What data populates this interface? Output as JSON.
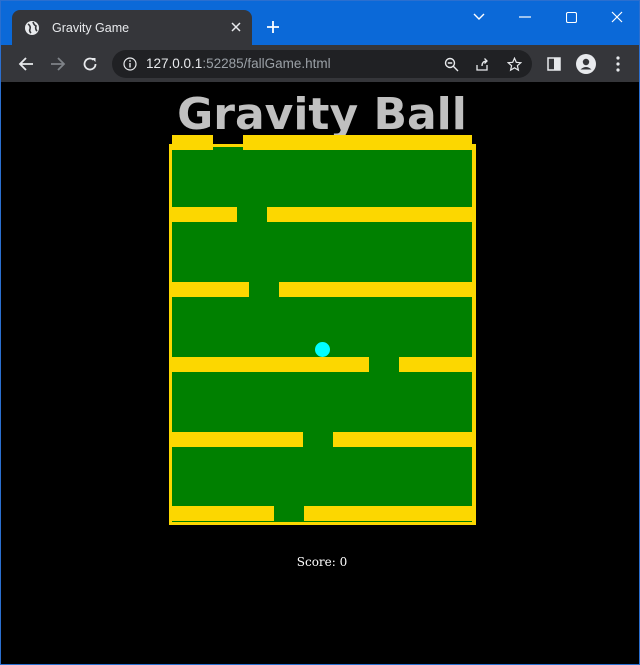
{
  "browser": {
    "tab_title": "Gravity Game",
    "url_host": "127.0.0.1",
    "url_rest": ":52285/fallGame.html"
  },
  "game": {
    "title": "Gravity Ball",
    "score_text": "Score: 0"
  },
  "colors": {
    "board_border": "#fcd700",
    "field": "#008000",
    "platform": "#fcd700",
    "ball": "#00ffff",
    "title": "#c0c0c0"
  }
}
